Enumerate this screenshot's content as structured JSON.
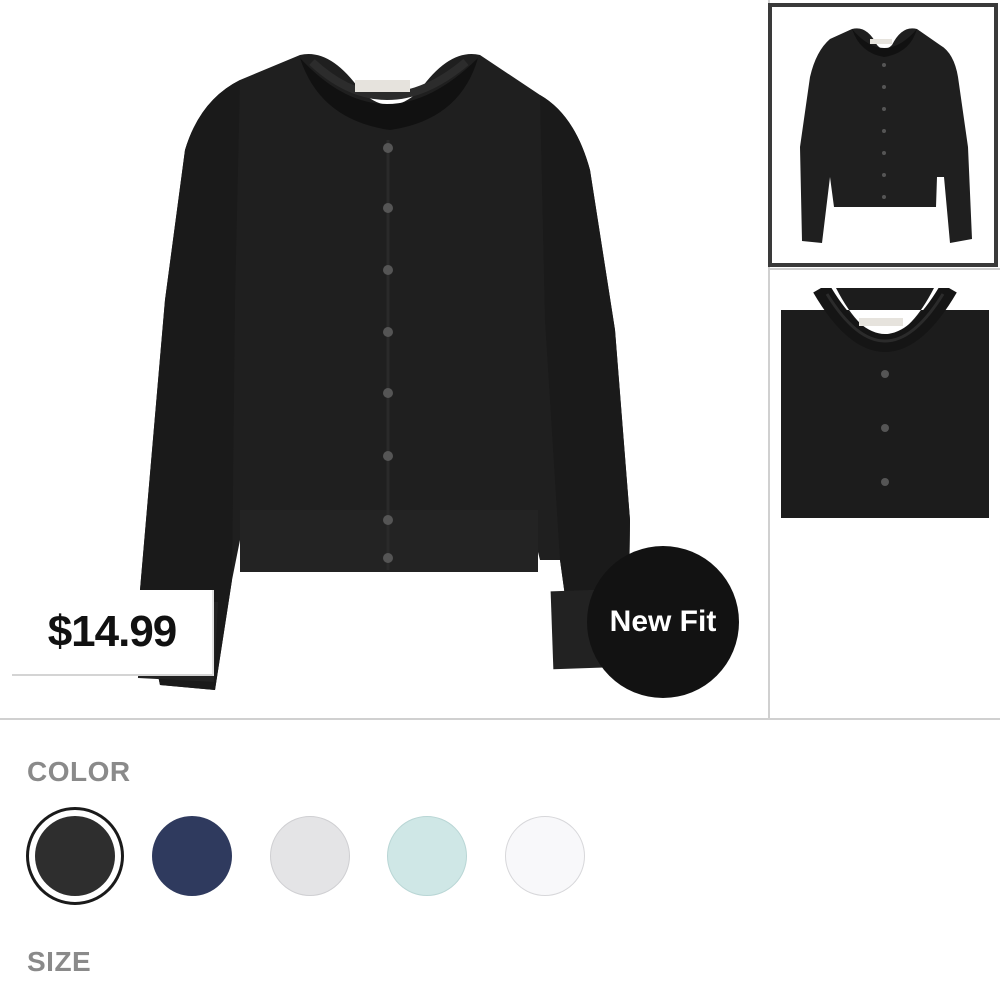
{
  "product": {
    "price": "$14.99",
    "badge": "New Fit"
  },
  "thumbnails": [
    {
      "name": "full-front",
      "selected": true
    },
    {
      "name": "neckline-detail",
      "selected": false
    }
  ],
  "color_section": {
    "label": "COLOR",
    "swatches": [
      {
        "name": "black",
        "hex": "#2e2e2e",
        "selected": true
      },
      {
        "name": "navy",
        "hex": "#2f3a5e",
        "selected": false
      },
      {
        "name": "light-gray",
        "hex": "#e4e4e6",
        "selected": false
      },
      {
        "name": "mint",
        "hex": "#cfe7e6",
        "selected": false
      },
      {
        "name": "white",
        "hex": "#f8f8fa",
        "selected": false
      }
    ]
  },
  "size_section": {
    "label": "SIZE"
  }
}
